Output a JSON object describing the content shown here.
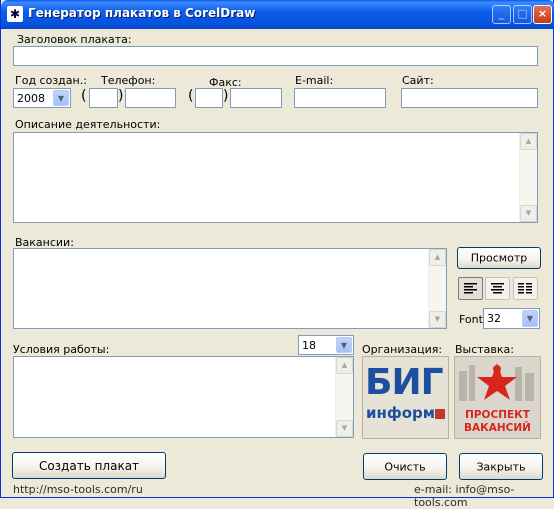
{
  "window": {
    "title": "Генератор плакатов в CorelDraw"
  },
  "labels": {
    "poster_title": "Заголовок плаката:",
    "year": "Год создан.:",
    "phone": "Телефон:",
    "fax": "Факс:",
    "email": "E-mail:",
    "site": "Сайт:",
    "description": "Описание деятельности:",
    "vacancies": "Вакансии:",
    "conditions": "Условия работы:",
    "organization": "Организация:",
    "exhibition": "Выставка:",
    "font": "Font"
  },
  "fields": {
    "poster_title": "",
    "year": "2008",
    "phone_code": "",
    "phone": "",
    "fax_code": "",
    "fax": "",
    "email": "",
    "site": "",
    "conditions_size": "18",
    "font_size": "32"
  },
  "buttons": {
    "preview": "Просмотр",
    "create": "Создать плакат",
    "clear": "Очисть",
    "close": "Закрыть"
  },
  "logos": {
    "organization_line1": "БИГ",
    "organization_line2": "информ",
    "exhibition_line1": "ПРОСПЕКТ",
    "exhibition_line2": "ВАКАНСИЙ"
  },
  "status": {
    "site": "http://mso-tools.com/ru",
    "email": "e-mail: info@mso-tools.com"
  },
  "colors": {
    "titlebar": "#0B5FE8",
    "window_bg": "#ECE9D8",
    "field_border": "#7F9DB9",
    "logo_blue": "#1D4FA0",
    "logo_red": "#D8261C"
  }
}
